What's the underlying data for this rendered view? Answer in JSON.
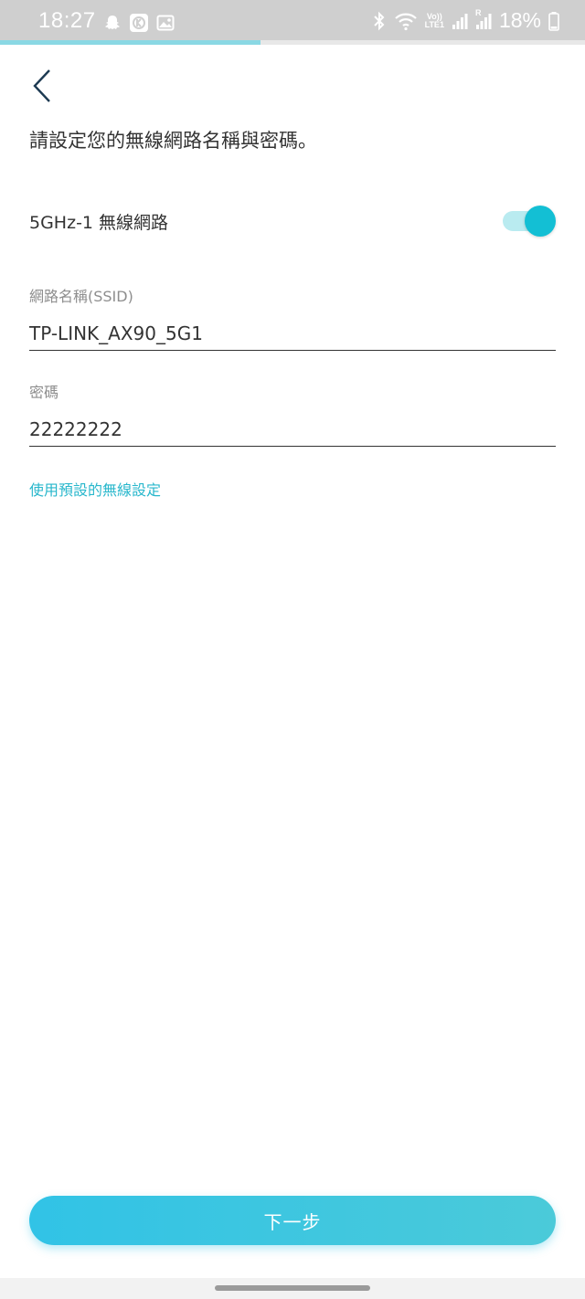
{
  "status_bar": {
    "time": "18:27",
    "battery_percent": "18%",
    "left_icons": [
      "snapchat-icon",
      "k-app-icon",
      "gallery-icon"
    ],
    "right_icons": [
      "bluetooth-icon",
      "wifi-icon",
      "volte-icon",
      "signal-icon",
      "signal-roaming-icon",
      "battery-icon"
    ],
    "volte_text": "Vo))",
    "lte_text": "LTE1",
    "roaming_text": "R"
  },
  "progress": {
    "fraction": 0.445,
    "color": "#8ad8e4"
  },
  "header": {
    "back_icon": "chevron-left-icon",
    "heading": "請設定您的無線網路名稱與密碼。"
  },
  "band": {
    "label": "5GHz-1 無線網路",
    "enabled": true,
    "accent_color": "#13bfd4"
  },
  "form": {
    "ssid_label": "網路名稱(SSID)",
    "ssid_value": "TP-LINK_AX90_5G1",
    "password_label": "密碼",
    "password_value": "22222222"
  },
  "default_settings_link": "使用預設的無線設定",
  "next_button": "下一步"
}
